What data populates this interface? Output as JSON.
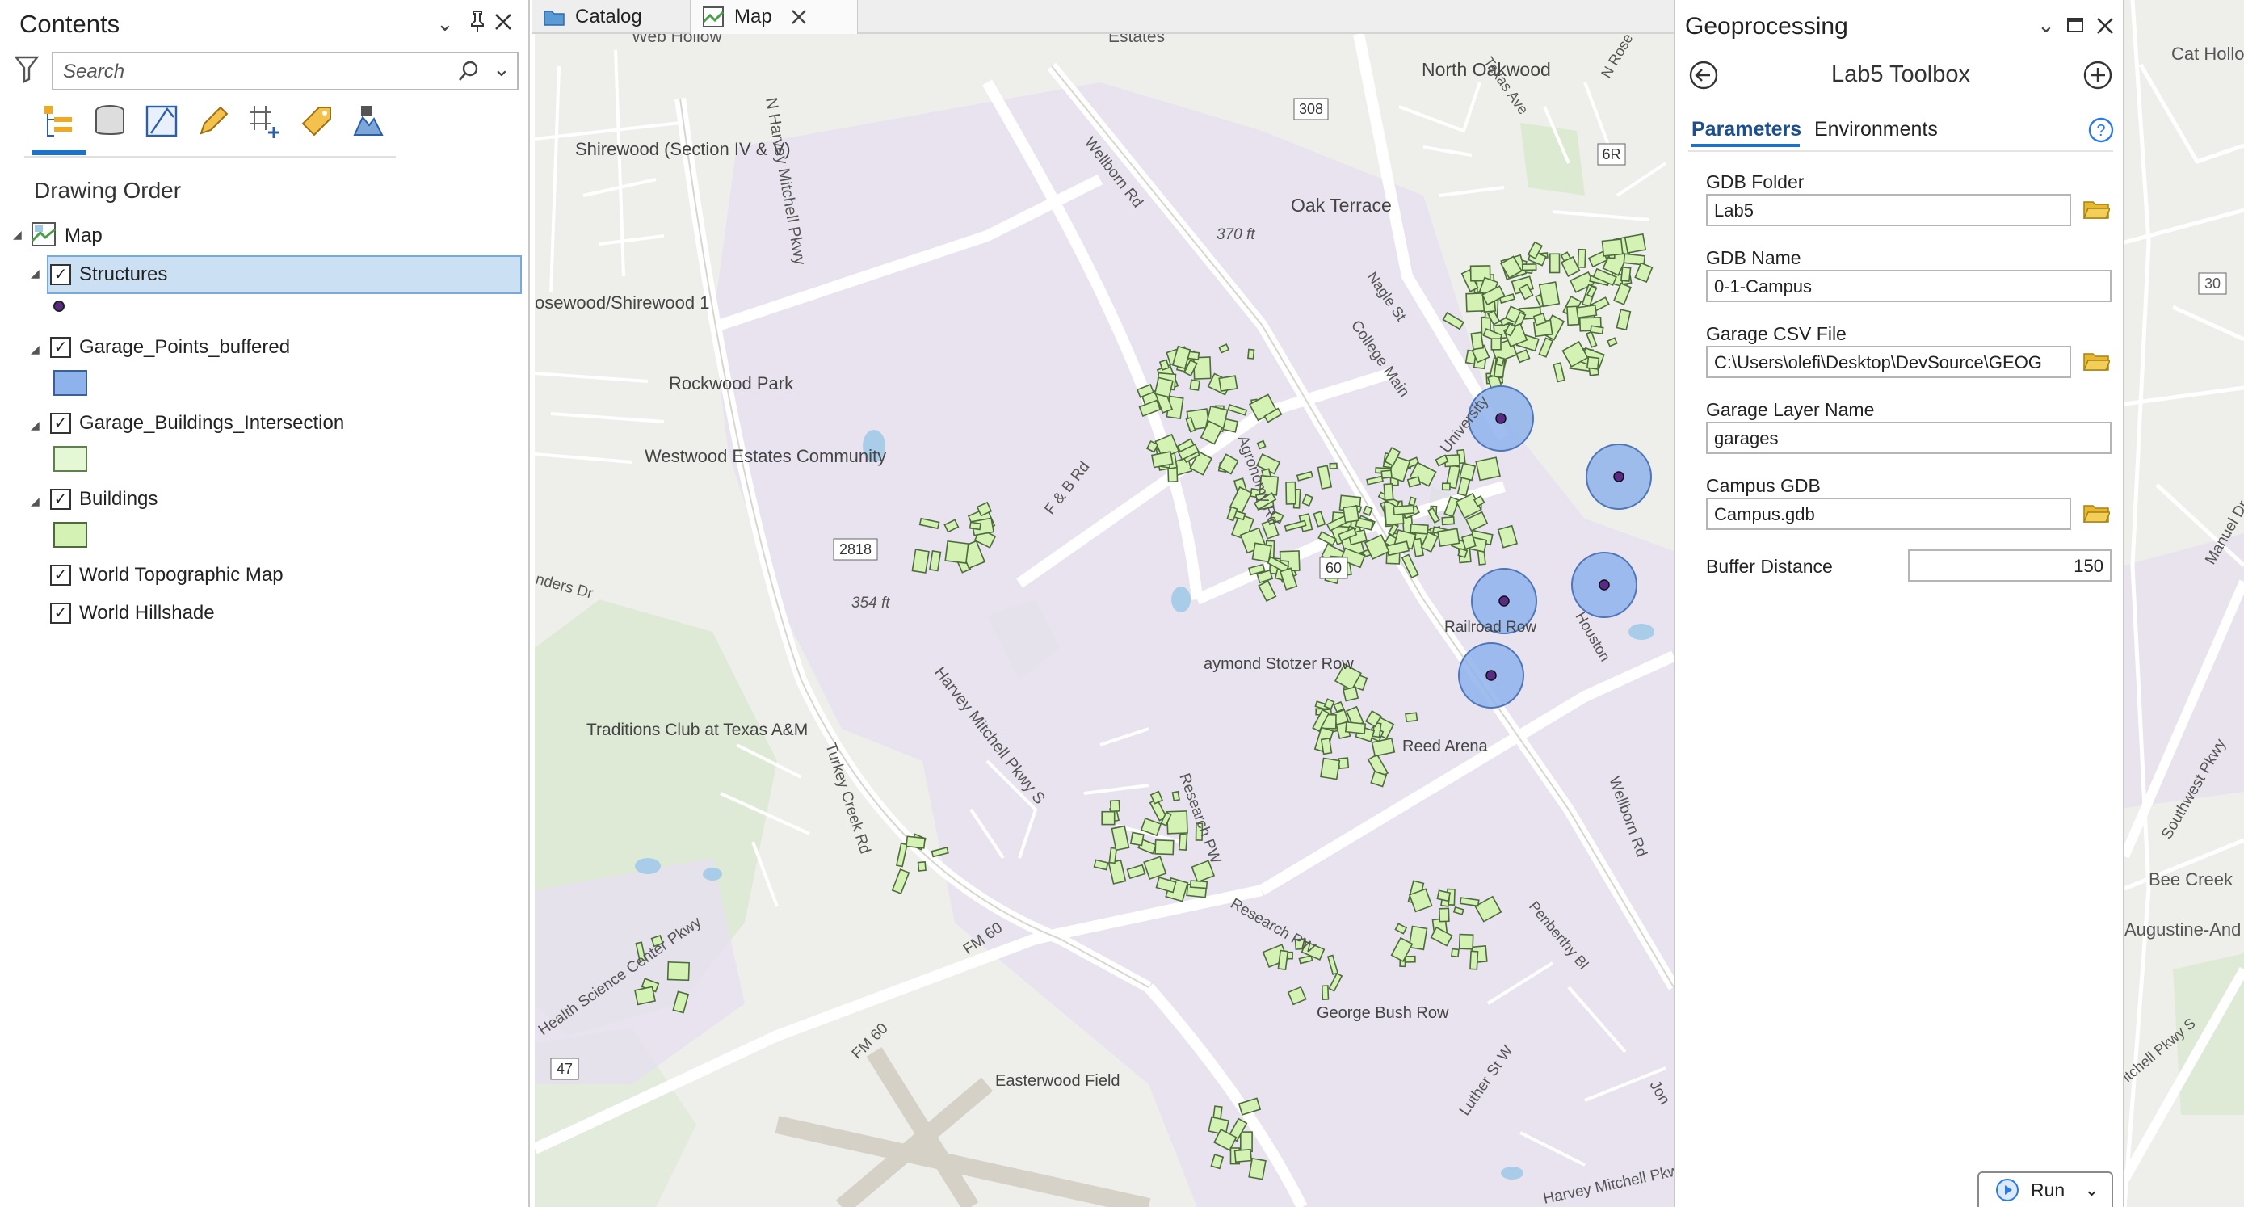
{
  "contents_pane": {
    "title": "Contents",
    "search_placeholder": "Search",
    "drawing_order_label": "Drawing Order",
    "map_label": "Map",
    "layers": [
      {
        "name": "Structures",
        "checked": true,
        "selected": true,
        "symbol": "point"
      },
      {
        "name": "Garage_Points_buffered",
        "checked": true,
        "symbol": "blue-fill"
      },
      {
        "name": "Garage_Buildings_Intersection",
        "checked": true,
        "symbol": "pale-green-fill"
      },
      {
        "name": "Buildings",
        "checked": true,
        "symbol": "green-fill"
      },
      {
        "name": "World Topographic Map",
        "checked": true
      },
      {
        "name": "World Hillshade",
        "checked": true
      }
    ]
  },
  "view_tabs": [
    {
      "label": "Catalog",
      "icon": "catalog-icon"
    },
    {
      "label": "Map",
      "icon": "map-icon",
      "active": true
    }
  ],
  "map_labels": {
    "web_hollow": "Web Hollow",
    "estates": "Estates",
    "north_oakwood": "North Oakwood",
    "texas_ave": "Texas Ave",
    "n_rose": "N Rose",
    "shirewood": "Shirewood (Section IV & V)",
    "n_harvey": "N Harvey Mitchell Pkwy",
    "wellborn_rd": "Wellborn Rd",
    "oak_terrace": "Oak Terrace",
    "shield_308": "308",
    "shield_6r": "6R",
    "elev_370": "370 ft",
    "nagle_st": "Nagle St",
    "college_main": "College Main",
    "osewood": "osewood/Shirewood 1",
    "rockwood_park": "Rockwood Park",
    "westwood": "Westwood Estates Community",
    "fb_rd": "F & B Rd",
    "agronomy": "Agronomy Rd",
    "university": "University",
    "shield_2818": "2818",
    "shield_60": "60",
    "anders_dr": "nders Dr",
    "elev_354": "354 ft",
    "railroad_row": "Railroad Row",
    "houston": "Houston",
    "harvey_s": "Harvey Mitchell Pkwy S",
    "raymond": "aymond Stotzer Row",
    "traditions": "Traditions Club at Texas A&M",
    "turkey_creek": "Turkey Creek Rd",
    "reed_arena": "Reed Arena",
    "research_pw": "Research PW",
    "research_pw2": "Research PW",
    "wellborn_rd2": "Wellborn Rd",
    "penberthy": "Penberthy Bl",
    "hsc_pkwy": "Health Science Center Pkwy",
    "fm60": "FM 60",
    "fm60b": "FM 60",
    "shield_47": "47",
    "easterwood": "Easterwood Field",
    "george_bush": "George Bush Row",
    "luther": "Luther St W",
    "jon": "Jon",
    "harvey_bottom": "Harvey Mitchell Pkw"
  },
  "right_map_labels": {
    "cat_hollow": "Cat Hollo",
    "shield_30": "30",
    "manuel": "Manuel Dr",
    "southwest": "Southwest Pkwy",
    "bee_creek": "Bee Creek",
    "augustine": "Augustine-And",
    "mitchell": "itchell Pkwy S"
  },
  "geoprocessing": {
    "title": "Geoprocessing",
    "tool_title": "Lab5 Toolbox",
    "tabs": [
      "Parameters",
      "Environments"
    ],
    "params": [
      {
        "label": "GDB Folder",
        "value": "Lab5",
        "browse": true
      },
      {
        "label": "GDB Name",
        "value": "0-1-Campus",
        "browse": false
      },
      {
        "label": "Garage CSV File",
        "value": "C:\\Users\\olefi\\Desktop\\DevSource\\GEOG",
        "browse": true
      },
      {
        "label": "Garage Layer Name",
        "value": "garages",
        "browse": false
      },
      {
        "label": "Campus GDB",
        "value": "Campus.gdb",
        "browse": true
      },
      {
        "label": "Buffer Distance",
        "value": "150",
        "browse": false
      }
    ],
    "run_label": "Run"
  },
  "colors": {
    "accent": "#1c72c8",
    "building_fill": "#d3f2b4",
    "building_stroke": "#4d6b3c",
    "buffer_fill": "#8eb3ec",
    "campus_area": "#e6e0ee",
    "selection": "#cce0f4"
  }
}
